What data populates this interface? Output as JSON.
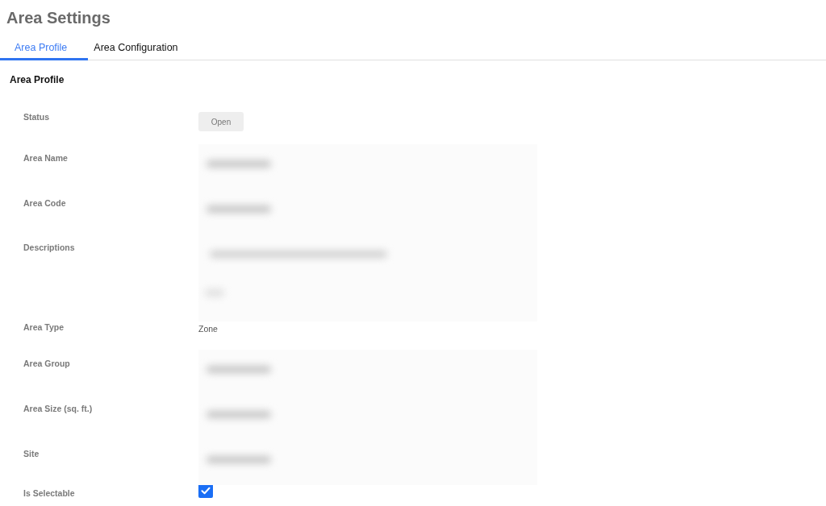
{
  "page": {
    "title": "Area Settings"
  },
  "tabs": [
    {
      "label": "Area Profile",
      "selected": true
    },
    {
      "label": "Area Configuration",
      "selected": false
    }
  ],
  "section": {
    "title": "Area Profile"
  },
  "fields": [
    {
      "label": "Status",
      "kind": "button",
      "value": "Open"
    },
    {
      "label": "Area Name",
      "kind": "input"
    },
    {
      "label": "Area Code",
      "kind": "input"
    },
    {
      "label": "Descriptions",
      "kind": "textarea"
    },
    {
      "label": "Area Type",
      "kind": "text",
      "value": "Zone"
    },
    {
      "label": "Area Group",
      "kind": "input"
    },
    {
      "label": "Area Size (sq. ft.)",
      "kind": "input"
    },
    {
      "label": "Site",
      "kind": "input"
    },
    {
      "label": "Is Selectable",
      "kind": "checkbox",
      "checked": true
    }
  ]
}
